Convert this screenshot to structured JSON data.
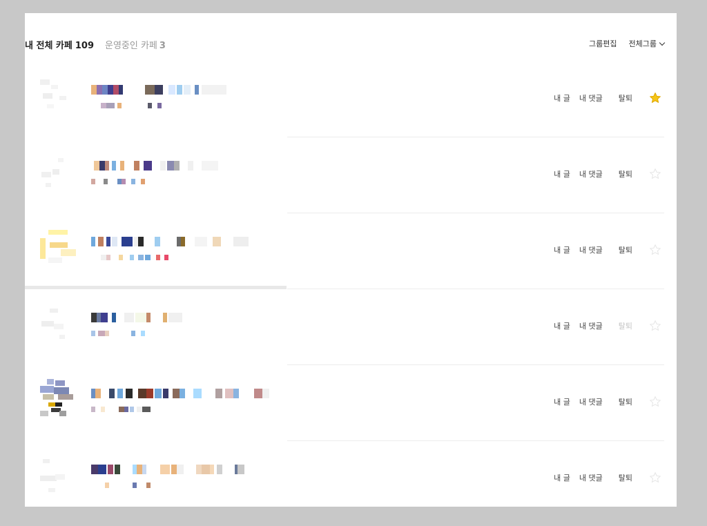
{
  "header": {
    "title": "내 전체 카페",
    "title_count": "109",
    "sub_label": "운영중인 카페",
    "sub_count": "3",
    "group_edit": "그룹편집",
    "group_filter": "전체그룹"
  },
  "rows": [
    {
      "my_posts": "내 글",
      "my_comments": "내 댓글",
      "leave": "탈퇴",
      "favorite": true,
      "leave_disabled": false
    },
    {
      "my_posts": "내 글",
      "my_comments": "내 댓글",
      "leave": "탈퇴",
      "favorite": false,
      "leave_disabled": false
    },
    {
      "my_posts": "내 글",
      "my_comments": "내 댓글",
      "leave": "탈퇴",
      "favorite": false,
      "leave_disabled": false
    },
    {
      "my_posts": "내 글",
      "my_comments": "내 댓글",
      "leave": "탈퇴",
      "favorite": false,
      "leave_disabled": true
    },
    {
      "my_posts": "내 글",
      "my_comments": "내 댓글",
      "leave": "탈퇴",
      "favorite": false,
      "leave_disabled": false
    },
    {
      "my_posts": "내 글",
      "my_comments": "내 댓글",
      "leave": "탈퇴",
      "favorite": false,
      "leave_disabled": false
    }
  ],
  "colors": {
    "backdrop": "#c8c8c8",
    "panel": "#ffffff",
    "star_on": "#f5c518",
    "star_off": "#e6e6e6"
  }
}
